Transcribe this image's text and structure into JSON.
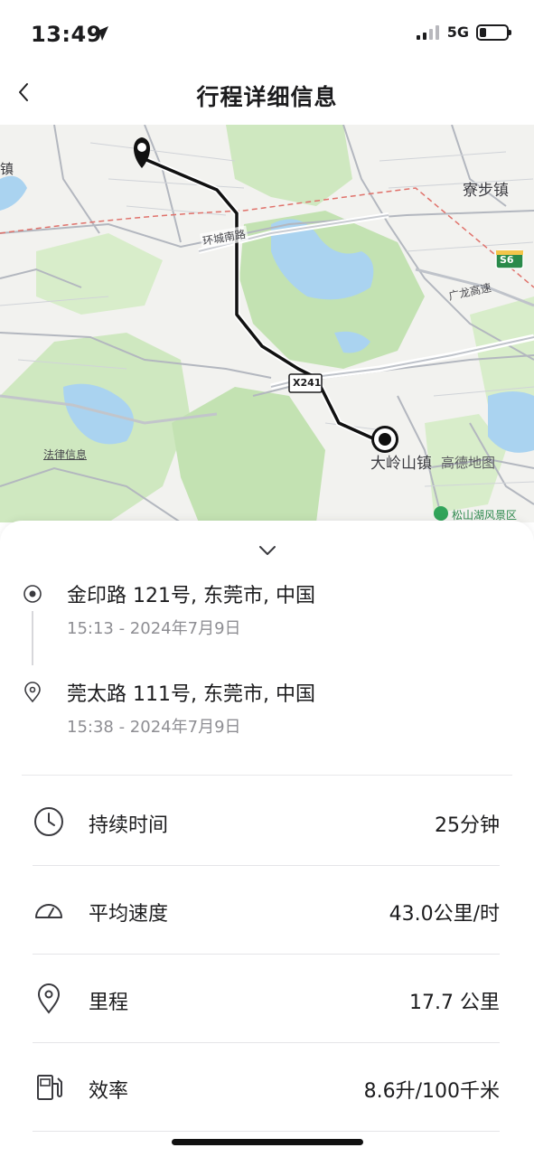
{
  "status_bar": {
    "time": "13:49",
    "network": "5G",
    "battery_level": 0.25,
    "icons": [
      "location-arrow-icon",
      "signal-icon",
      "battery-icon"
    ]
  },
  "nav": {
    "title": "行程详细信息",
    "back_icon": "chevron-left-icon"
  },
  "map": {
    "labels": {
      "road_ring_south": "环城南路",
      "town_liaobu": "寮步镇",
      "highway_guanglong": "广龙高速",
      "highway_s6": "S6",
      "road_x241": "X241",
      "town_dalingshan": "大岭山镇",
      "brand": "高德地图",
      "legal": "法律信息",
      "scenic": "松山湖风景区",
      "edge_town": "镇"
    },
    "route_color": "#111111",
    "start_icon": "map-pin-icon",
    "end_icon": "destination-dot-icon"
  },
  "trip": {
    "collapse_icon": "chevron-down-icon",
    "start": {
      "address": "金印路 121号, 东莞市, 中国",
      "time": "15:13 - 2024年7月9日",
      "icon": "start-target-icon"
    },
    "end": {
      "address": "莞太路 111号, 东莞市, 中国",
      "time": "15:38 - 2024年7月9日",
      "icon": "location-pin-icon"
    }
  },
  "stats": [
    {
      "label": "持续时间",
      "value": "25分钟",
      "icon": "clock-icon"
    },
    {
      "label": "平均速度",
      "value": "43.0公里/时",
      "icon": "speedometer-icon"
    },
    {
      "label": "里程",
      "value": "17.7 公里",
      "icon": "location-pin-icon"
    },
    {
      "label": "效率",
      "value": "8.6升/100千米",
      "icon": "fuel-pump-icon"
    }
  ]
}
